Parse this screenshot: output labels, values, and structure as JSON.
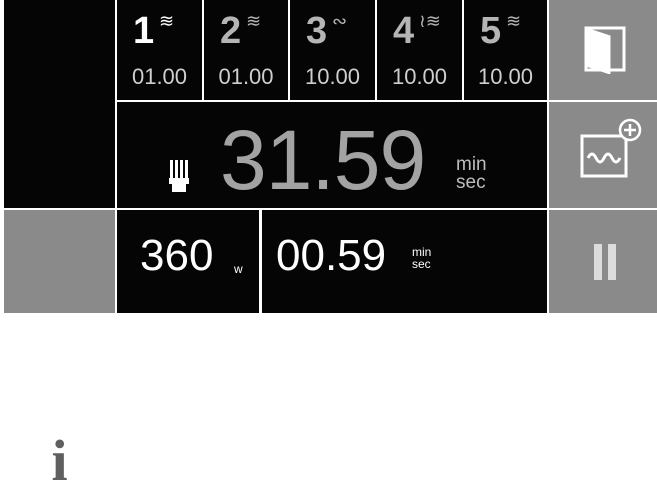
{
  "stages": [
    {
      "number": "1",
      "symbol": "≋",
      "time": "01.00",
      "icon": "waves-icon",
      "active": true
    },
    {
      "number": "2",
      "symbol": "≋",
      "time": "01.00",
      "icon": "waves-icon",
      "active": false
    },
    {
      "number": "3",
      "symbol": "∾",
      "time": "10.00",
      "icon": "wave-icon",
      "active": false
    },
    {
      "number": "4",
      "symbol": "≀≋",
      "time": "10.00",
      "icon": "combined-wave-icon",
      "active": false
    },
    {
      "number": "5",
      "symbol": "≋",
      "time": "10.00",
      "icon": "waves-icon",
      "active": false
    }
  ],
  "main": {
    "total_time": "31.59",
    "unit_top": "min",
    "unit_bottom": "sec",
    "icon": "comb-icon"
  },
  "bottom": {
    "power": "360",
    "power_unit": "w",
    "stage_time": "00.59",
    "unit_top": "min",
    "unit_bottom": "sec"
  },
  "left": {
    "info_label": "i"
  },
  "right": {
    "door_icon": "door-icon",
    "add_icon": "add-water-icon",
    "pause_icon": "pause-icon"
  },
  "colors": {
    "background": "#050505",
    "button_gray": "#8a8a8a",
    "text": "#ffffff",
    "dim_text": "#a3a3a3"
  }
}
